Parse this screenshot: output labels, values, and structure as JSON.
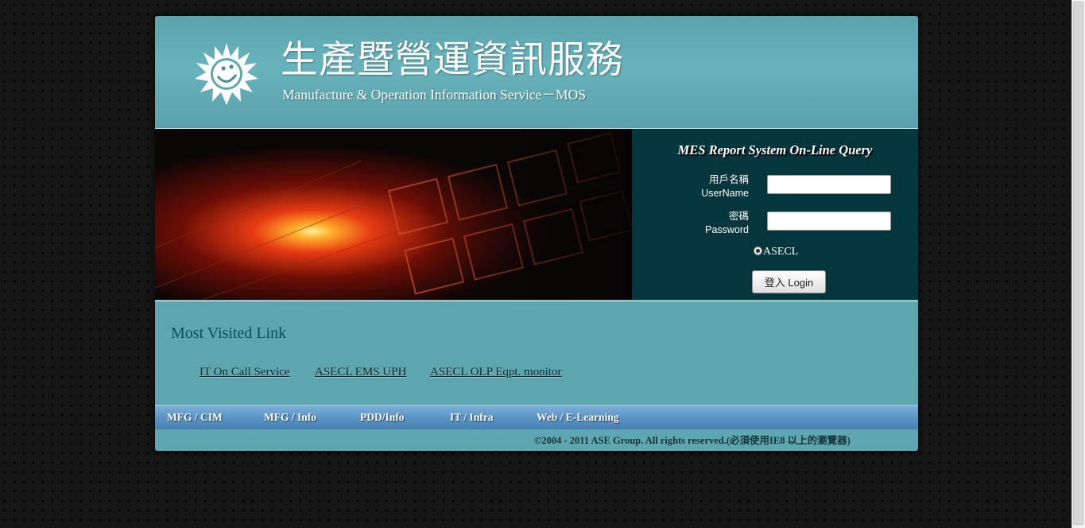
{
  "header": {
    "title_cn": "生產暨營運資訊服務",
    "title_en": "Manufacture & Operation Information Service－MOS",
    "logo_icon": "sun-smile-logo"
  },
  "banner": {
    "image": "chip-die-photo"
  },
  "login": {
    "title": "MES Report System On-Line Query",
    "username_label_cn": "用戶名稱",
    "username_label_en": "UserName",
    "username_value": "",
    "password_label_cn": "密碼",
    "password_label_en": "Password",
    "password_value": "",
    "radio_option": "ASECL",
    "radio_selected": true,
    "button_label": "登入 Login"
  },
  "links": {
    "heading": "Most Visited Link",
    "items": [
      {
        "label": "IT On Call Service"
      },
      {
        "label": "ASECL EMS UPH"
      },
      {
        "label": "ASECL OLP Eqpt. monitor"
      }
    ]
  },
  "nav": {
    "items": [
      {
        "label": "MFG / CIM"
      },
      {
        "label": "MFG / Info"
      },
      {
        "label": "PDD/Info"
      },
      {
        "label": "IT / Infra"
      },
      {
        "label": "Web / E-Learning"
      }
    ]
  },
  "footer": {
    "text": "©2004 - 2011 ASE Group. All rights reserved.(必須使用IE8 以上的瀏覽器)"
  },
  "colors": {
    "header_teal": "#5ea7b0",
    "login_panel": "#05363d",
    "nav_blue": "#5d98c9",
    "link_heading": "#0e4c5d"
  }
}
